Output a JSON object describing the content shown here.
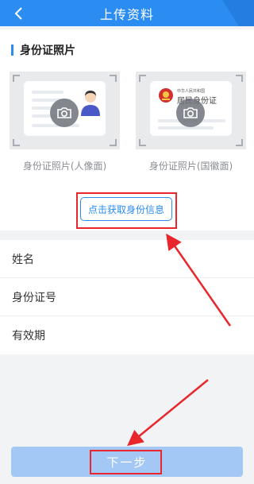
{
  "header": {
    "title": "上传资料",
    "back_icon": "chevron-left-icon"
  },
  "section": {
    "title": "身份证照片"
  },
  "cards": [
    {
      "caption": "身份证照片(人像面)",
      "icon": "camera-icon"
    },
    {
      "caption": "身份证照片(国徽面)",
      "icon": "camera-icon",
      "emblem_small_text": "中华人民共和国",
      "emblem_title": "居民身份证"
    }
  ],
  "get_info_button": "点击获取身份信息",
  "form": {
    "rows": [
      {
        "label": "姓名"
      },
      {
        "label": "身份证号"
      },
      {
        "label": "有效期"
      }
    ]
  },
  "next_button": "下一步",
  "colors": {
    "primary": "#2b8cf2",
    "annotation": "#e8262c",
    "disabled_button": "#a3c8f5"
  }
}
